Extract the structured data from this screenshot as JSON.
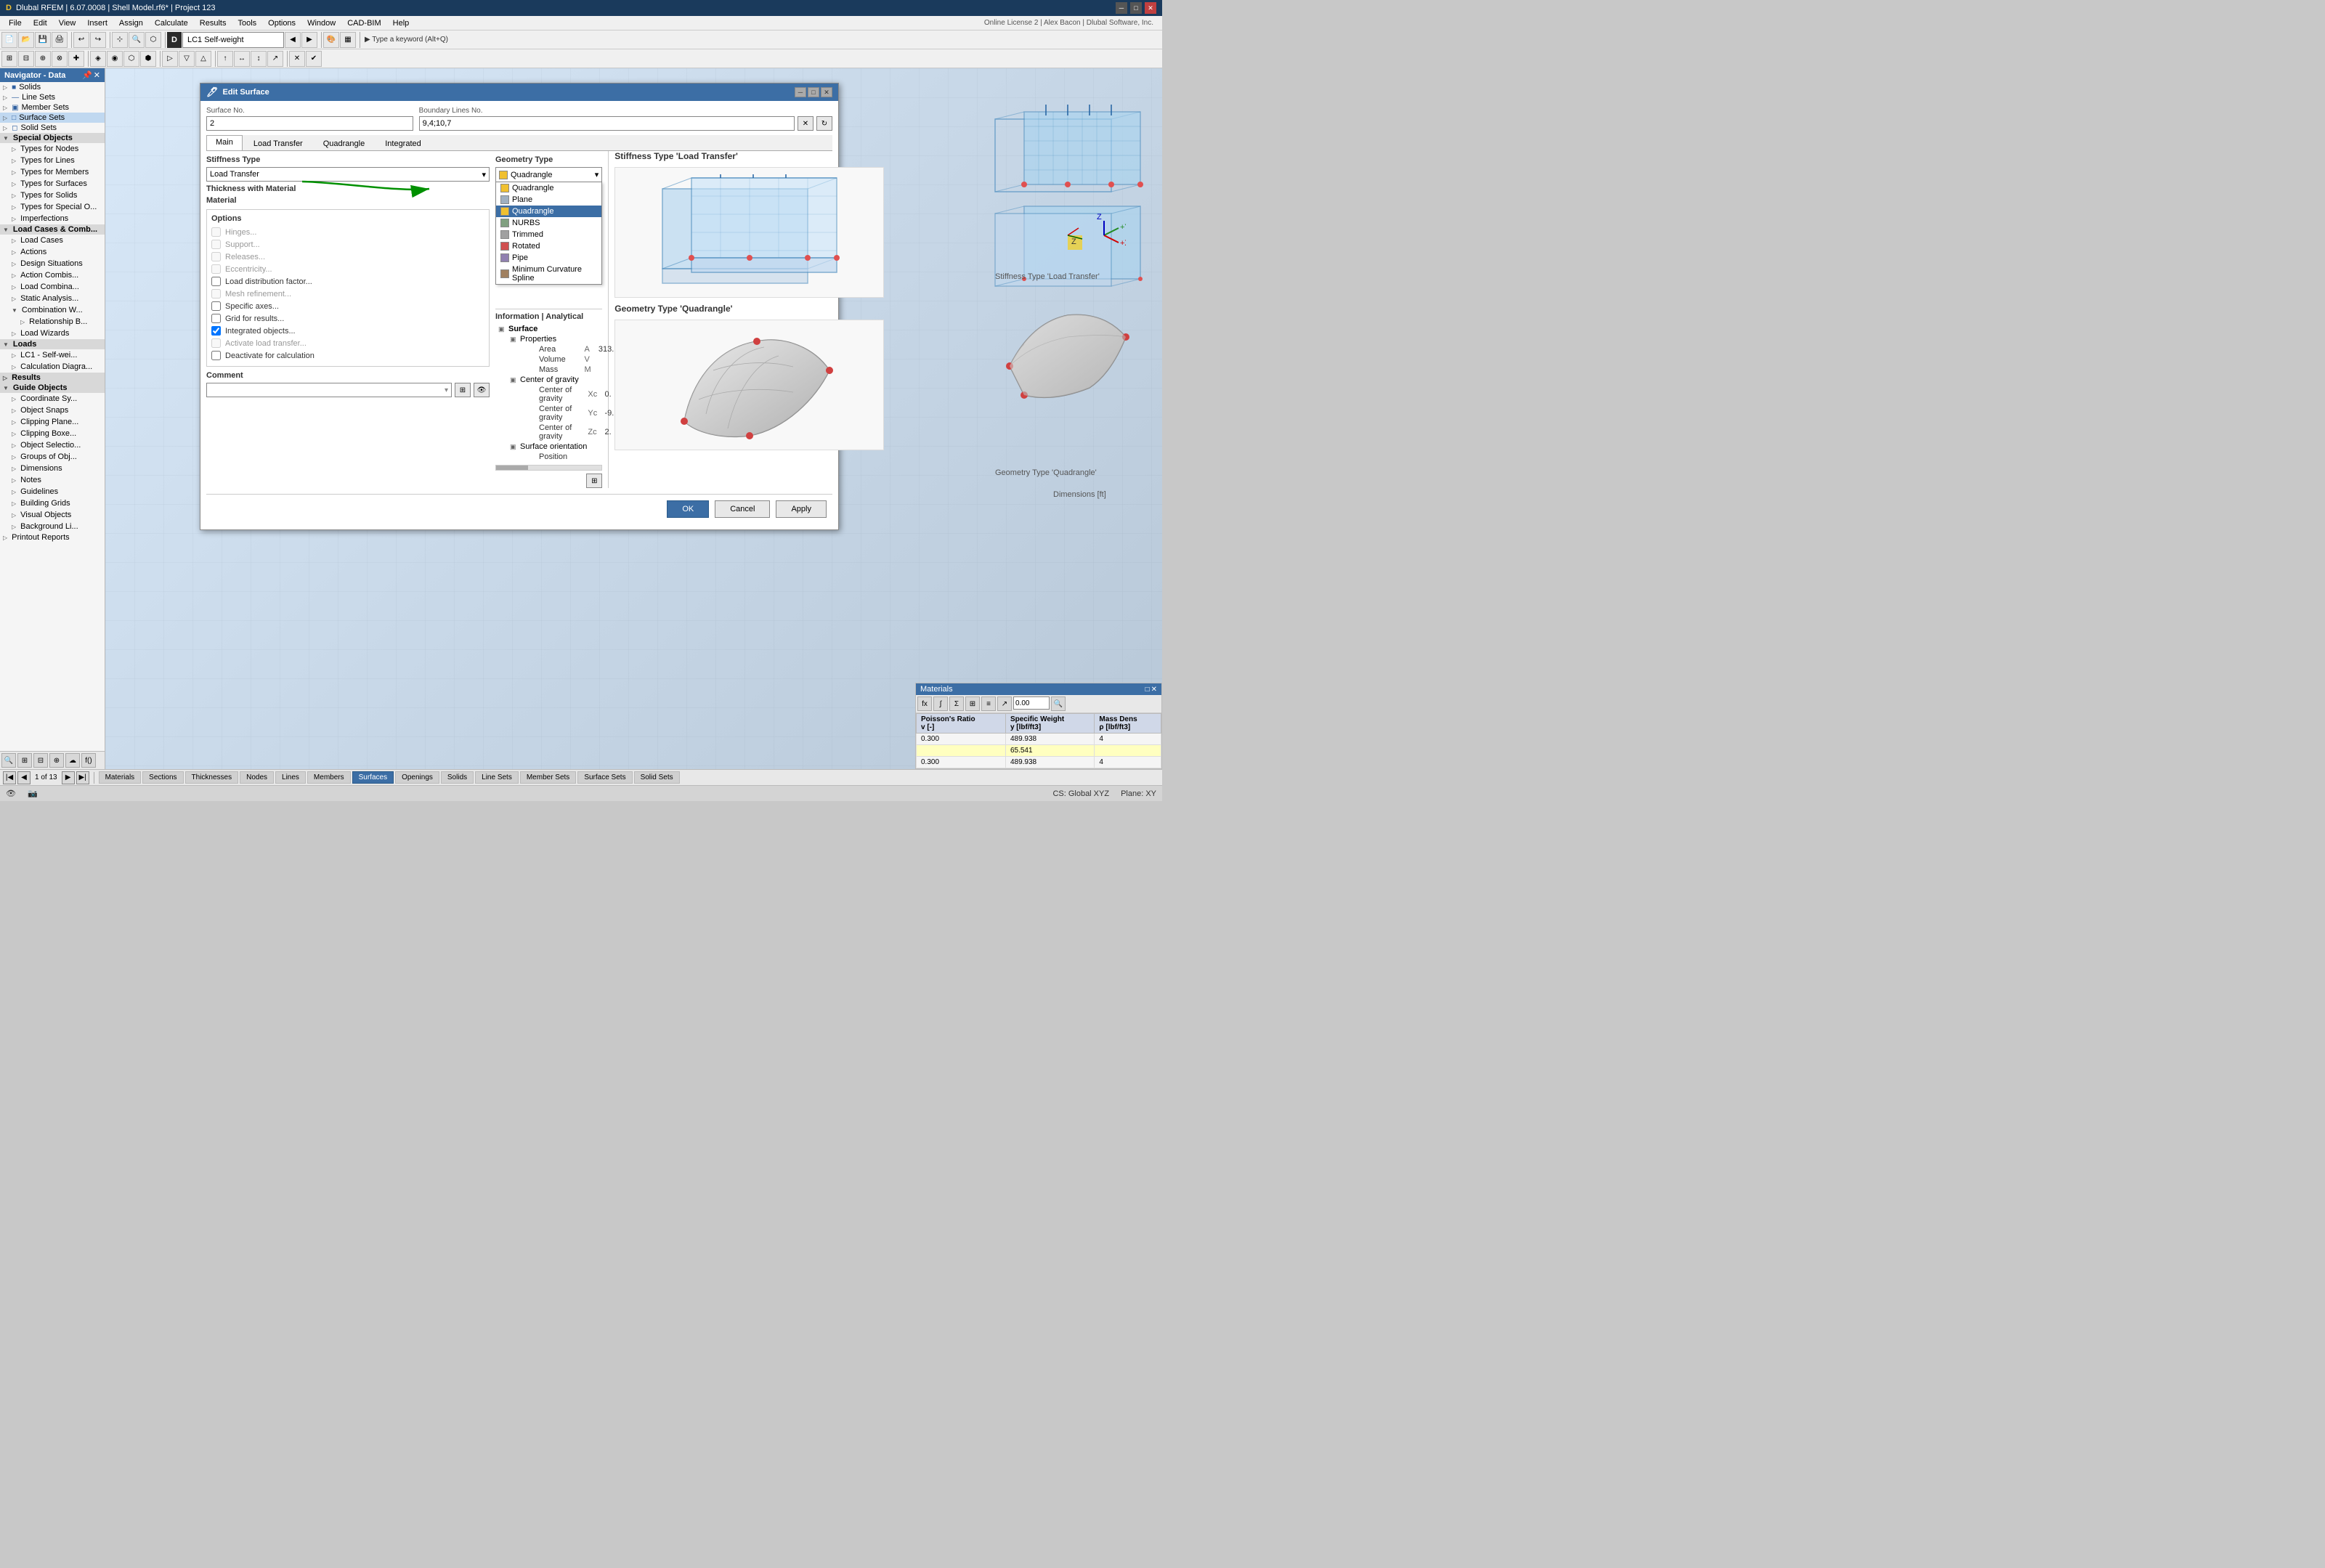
{
  "app": {
    "title": "Dlubal RFEM | 6.07.0008 | Shell Model.rf6* | Project 123",
    "icon": "D"
  },
  "menu": {
    "items": [
      "File",
      "Edit",
      "View",
      "Insert",
      "Assign",
      "Calculate",
      "Results",
      "Tools",
      "Options",
      "Window",
      "CAD-BIM",
      "Help"
    ]
  },
  "lc_dropdown": {
    "label": "LC1  Self-weight"
  },
  "navigator": {
    "title": "Navigator - Data",
    "items": [
      {
        "label": "Solids",
        "icon": "■",
        "expanded": false
      },
      {
        "label": "Line Sets",
        "icon": "—",
        "expanded": false
      },
      {
        "label": "Member Sets",
        "icon": "▣",
        "expanded": false
      },
      {
        "label": "Surface Sets",
        "icon": "□",
        "expanded": false
      },
      {
        "label": "Solid Sets",
        "icon": "◻",
        "expanded": false
      },
      {
        "label": "Special Objects",
        "icon": "◆",
        "expanded": false,
        "group": true
      },
      {
        "label": "Types for Nodes",
        "icon": "•",
        "expanded": false
      },
      {
        "label": "Types for Lines",
        "icon": "—",
        "expanded": false
      },
      {
        "label": "Types for Members",
        "icon": "═",
        "expanded": false
      },
      {
        "label": "Types for Surfaces",
        "icon": "□",
        "expanded": false
      },
      {
        "label": "Types for Solids",
        "icon": "■",
        "expanded": false
      },
      {
        "label": "Types for Special O",
        "icon": "◆",
        "expanded": false
      },
      {
        "label": "Imperfections",
        "icon": "~",
        "expanded": false
      },
      {
        "label": "Load Cases & Comb",
        "icon": "≡",
        "expanded": true,
        "group": true
      },
      {
        "label": "Load Cases",
        "icon": "≡",
        "expanded": false,
        "indent": 1
      },
      {
        "label": "Actions",
        "icon": "!",
        "expanded": false,
        "indent": 1
      },
      {
        "label": "Design Situations",
        "icon": "D",
        "expanded": false,
        "indent": 1
      },
      {
        "label": "Action Combis...",
        "icon": "A",
        "expanded": false,
        "indent": 1
      },
      {
        "label": "Load Combina...",
        "icon": "L",
        "expanded": false,
        "indent": 1
      },
      {
        "label": "Static Analysis...",
        "icon": "S",
        "expanded": false,
        "indent": 1
      },
      {
        "label": "Combination W...",
        "icon": "C",
        "expanded": false,
        "indent": 1
      },
      {
        "label": "Relationship B...",
        "icon": "R",
        "expanded": false,
        "indent": 2
      },
      {
        "label": "Load Wizards",
        "icon": "W",
        "expanded": false,
        "indent": 1
      },
      {
        "label": "Loads",
        "icon": "↓",
        "expanded": true,
        "group": true
      },
      {
        "label": "LC1 - Self-wei...",
        "icon": "↓",
        "expanded": false,
        "indent": 1
      },
      {
        "label": "Calculation Diagra...",
        "icon": "G",
        "expanded": false,
        "indent": 1
      },
      {
        "label": "Results",
        "icon": "R",
        "expanded": false,
        "group": true
      },
      {
        "label": "Guide Objects",
        "icon": "G",
        "expanded": true,
        "group": true
      },
      {
        "label": "Coordinate Sy...",
        "icon": "⊕",
        "expanded": false,
        "indent": 1
      },
      {
        "label": "Object Snaps",
        "icon": "○",
        "expanded": false,
        "indent": 1
      },
      {
        "label": "Clipping Plane...",
        "icon": "▨",
        "expanded": false,
        "indent": 1
      },
      {
        "label": "Clipping Boxe...",
        "icon": "▦",
        "expanded": false,
        "indent": 1
      },
      {
        "label": "Object Selectio...",
        "icon": "▷",
        "expanded": false,
        "indent": 1
      },
      {
        "label": "Groups of Obj...",
        "icon": "⊞",
        "expanded": false,
        "indent": 1
      },
      {
        "label": "Dimensions",
        "icon": "↔",
        "expanded": false,
        "indent": 1
      },
      {
        "label": "Notes",
        "icon": "✎",
        "expanded": false,
        "indent": 1
      },
      {
        "label": "Guidelines",
        "icon": "⊟",
        "expanded": false,
        "indent": 1
      },
      {
        "label": "Building Grids",
        "icon": "⊞",
        "expanded": false,
        "indent": 1
      },
      {
        "label": "Visual Objects",
        "icon": "♦",
        "expanded": false,
        "indent": 1
      },
      {
        "label": "Background Li...",
        "icon": "▧",
        "expanded": false,
        "indent": 1
      },
      {
        "label": "Printout Reports",
        "icon": "🖨",
        "expanded": false
      }
    ]
  },
  "dialog": {
    "title": "Edit Surface",
    "surface_no_label": "Surface No.",
    "surface_no_value": "2",
    "boundary_lines_label": "Boundary Lines No.",
    "boundary_lines_value": "9,4;10,7",
    "tabs": [
      "Main",
      "Load Transfer",
      "Quadrangle",
      "Integrated"
    ],
    "active_tab": "Main",
    "stiffness_type_label": "Stiffness Type",
    "stiffness_type_value": "Load Transfer",
    "thickness_label": "Thickness with Material",
    "material_label": "Material",
    "geometry_type_label": "Geometry Type",
    "geometry_type_value": "Quadrangle",
    "options_label": "Options",
    "options": [
      {
        "label": "Hinges...",
        "checked": false,
        "enabled": false
      },
      {
        "label": "Support...",
        "checked": false,
        "enabled": false
      },
      {
        "label": "Releases...",
        "checked": false,
        "enabled": false
      },
      {
        "label": "Eccentricity...",
        "checked": false,
        "enabled": false
      },
      {
        "label": "Load distribution factor...",
        "checked": false,
        "enabled": true
      },
      {
        "label": "Mesh refinement...",
        "checked": false,
        "enabled": false
      },
      {
        "label": "Specific axes...",
        "checked": false,
        "enabled": true
      },
      {
        "label": "Grid for results...",
        "checked": false,
        "enabled": true
      },
      {
        "label": "Integrated objects...",
        "checked": true,
        "enabled": true
      },
      {
        "label": "Activate load transfer...",
        "checked": false,
        "enabled": false
      },
      {
        "label": "Deactivate for calculation",
        "checked": false,
        "enabled": true
      }
    ],
    "geometry_dropdown_items": [
      {
        "label": "Quadrangle",
        "color": "#f0c030"
      },
      {
        "label": "Plane",
        "color": "#a0b0c0"
      },
      {
        "label": "Quadrangle",
        "color": "#f0c030",
        "selected": true
      },
      {
        "label": "NURBS",
        "color": "#80a080"
      },
      {
        "label": "Trimmed",
        "color": "#a0a0a0"
      },
      {
        "label": "Rotated",
        "color": "#d05050"
      },
      {
        "label": "Pipe",
        "color": "#9080b0"
      },
      {
        "label": "Minimum Curvature Spline",
        "color": "#a08060"
      }
    ],
    "information_label": "Information | Analytical",
    "info_sections": [
      {
        "label": "Surface",
        "expanded": true,
        "sub": [
          {
            "label": "Properties",
            "expanded": true,
            "rows": [
              {
                "name": "Area",
                "sym": "A",
                "value": "313."
              },
              {
                "name": "Volume",
                "sym": "V",
                "value": ""
              },
              {
                "name": "Mass",
                "sym": "M",
                "value": ""
              }
            ]
          },
          {
            "label": "Center of gravity",
            "expanded": true,
            "rows": [
              {
                "name": "Center of gravity",
                "sym": "Xc",
                "value": "0."
              },
              {
                "name": "Center of gravity",
                "sym": "Yc",
                "value": "-9."
              },
              {
                "name": "Center of gravity",
                "sym": "Zc",
                "value": "2."
              }
            ]
          },
          {
            "label": "Surface orientation",
            "expanded": true,
            "rows": [
              {
                "name": "Position",
                "sym": "",
                "value": ""
              }
            ]
          }
        ]
      }
    ],
    "right_panel": {
      "stiffness_title": "Stiffness Type 'Load Transfer'",
      "geometry_title": "Geometry Type 'Quadrangle'"
    },
    "comment_label": "Comment",
    "buttons": {
      "ok": "OK",
      "cancel": "Cancel",
      "apply": "Apply"
    }
  },
  "bottom_tabs": {
    "nav_label": "1 of 13",
    "tabs": [
      "Materials",
      "Sections",
      "Thicknesses",
      "Nodes",
      "Lines",
      "Members",
      "Surfaces",
      "Openings",
      "Solids",
      "Line Sets",
      "Member Sets",
      "Surface Sets",
      "Solid Sets"
    ]
  },
  "status_bar": {
    "cs": "CS: Global XYZ",
    "plane": "Plane: XY"
  },
  "data_panel": {
    "headers": [
      "Poisson's Ratio v [-]",
      "Specific Weight y [lbf/ft3]",
      "Mass Dens ρ [lbf/ft3]"
    ],
    "rows": [
      {
        "ratio": "0.300",
        "weight": "489.938",
        "density": "4"
      },
      {
        "ratio": "",
        "weight": "65.541",
        "density": ""
      },
      {
        "ratio": "0.300",
        "weight": "489.938",
        "density": "4"
      }
    ]
  },
  "online_license": "Online License 2 | Alex Bacon | Dlubal Software, Inc."
}
